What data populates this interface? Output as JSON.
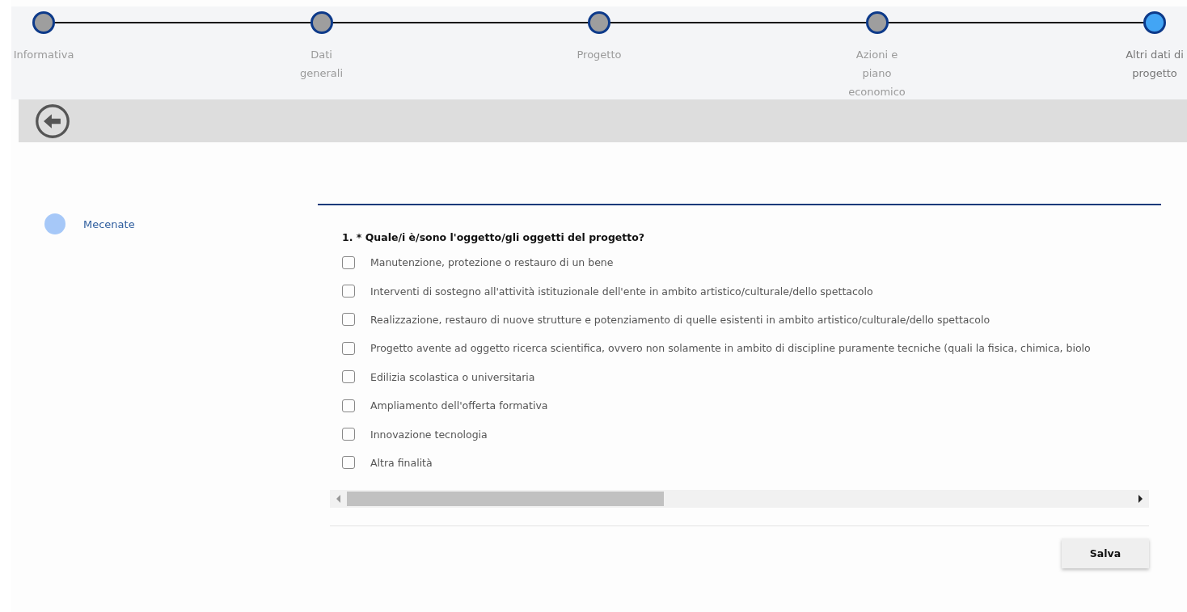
{
  "stepper": [
    {
      "label": "Informativa",
      "selected": false
    },
    {
      "label": "Dati generali",
      "selected": false
    },
    {
      "label": "Progetto",
      "selected": false
    },
    {
      "label": "Azioni e piano economico",
      "selected": false
    },
    {
      "label": "Altri dati di progetto",
      "selected": true
    }
  ],
  "sidebar": {
    "items": [
      {
        "label": "Mecenate"
      }
    ]
  },
  "question": {
    "title": "1. * Quale/i è/sono l'oggetto/gli oggetti del progetto?",
    "options": [
      {
        "label": "Manutenzione, protezione o restauro di un bene",
        "checked": false
      },
      {
        "label": "Interventi di sostegno all'attività istituzionale dell'ente in ambito artistico/culturale/dello spettacolo",
        "checked": false
      },
      {
        "label": "Realizzazione, restauro di nuove strutture e potenziamento di quelle esistenti in ambito artistico/culturale/dello spettacolo",
        "checked": false
      },
      {
        "label": "Progetto avente ad oggetto ricerca scientifica, ovvero non solamente in ambito di discipline puramente tecniche (quali la fisica, chimica, biolo",
        "checked": false
      },
      {
        "label": "Edilizia scolastica o universitaria",
        "checked": false
      },
      {
        "label": "Ampliamento dell'offerta formativa",
        "checked": false
      },
      {
        "label": "Innovazione tecnologia",
        "checked": false
      },
      {
        "label": "Altra finalità",
        "checked": false
      }
    ]
  },
  "buttons": [
    "Salva"
  ]
}
